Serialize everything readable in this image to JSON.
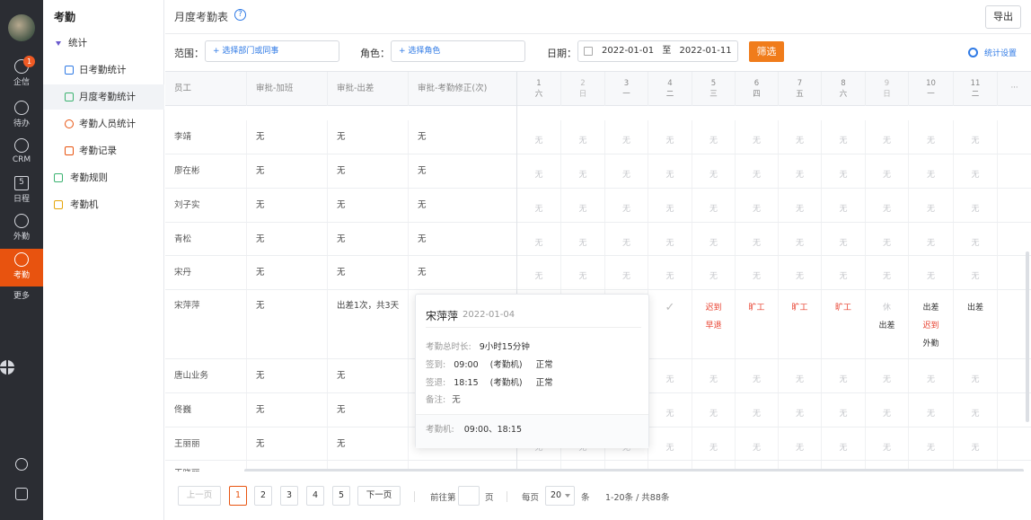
{
  "rail": {
    "items": [
      {
        "label": "企信",
        "badge": "1"
      },
      {
        "label": "待办"
      },
      {
        "label": "CRM"
      },
      {
        "label": "日程",
        "glyph": "5"
      },
      {
        "label": "外勤"
      },
      {
        "label": "考勤"
      },
      {
        "label": "更多"
      }
    ]
  },
  "sidebar": {
    "title": "考勤",
    "group": "统计",
    "items": [
      {
        "label": "日考勤统计"
      },
      {
        "label": "月度考勤统计"
      },
      {
        "label": "考勤人员统计"
      },
      {
        "label": "考勤记录"
      },
      {
        "label": "考勤规则"
      },
      {
        "label": "考勤机"
      }
    ]
  },
  "page": {
    "title": "月度考勤表",
    "help": "?",
    "export_label": "导出"
  },
  "filters": {
    "scope_label": "范围：",
    "scope_placeholder": "+ 选择部门或同事",
    "role_label": "角色：",
    "role_placeholder": "+ 选择角色",
    "date_label": "日期：",
    "date_start": "2022-01-01",
    "date_to": "至",
    "date_end": "2022-01-11",
    "filter_label": "筛选",
    "settings_label": "统计设置"
  },
  "table": {
    "headers": [
      "员工",
      "审批-加班",
      "审批-出差",
      "审批-考勤修正(次)"
    ],
    "days": [
      {
        "d": "1",
        "w": "六"
      },
      {
        "d": "2",
        "w": "日"
      },
      {
        "d": "3",
        "w": "一"
      },
      {
        "d": "4",
        "w": "二"
      },
      {
        "d": "5",
        "w": "三"
      },
      {
        "d": "6",
        "w": "四"
      },
      {
        "d": "7",
        "w": "五"
      },
      {
        "d": "8",
        "w": "六"
      },
      {
        "d": "9",
        "w": "日"
      },
      {
        "d": "10",
        "w": "一"
      },
      {
        "d": "11",
        "w": "二"
      }
    ],
    "more": "···",
    "rows": [
      {
        "name": "李靖",
        "ot": "无",
        "trip": "无",
        "fix": "无"
      },
      {
        "name": "廖在彬",
        "ot": "无",
        "trip": "无",
        "fix": "无"
      },
      {
        "name": "刘子实",
        "ot": "无",
        "trip": "无",
        "fix": "无"
      },
      {
        "name": "青松",
        "ot": "无",
        "trip": "无",
        "fix": "无"
      },
      {
        "name": "宋丹",
        "ot": "无",
        "trip": "无",
        "fix": "无"
      },
      {
        "name": "宋萍萍",
        "ot": "无",
        "trip": "出差1次，共3天",
        "fix": ""
      },
      {
        "name": "唐山业务",
        "ot": "无",
        "trip": "无",
        "fix": ""
      },
      {
        "name": "佟巍",
        "ot": "无",
        "trip": "无",
        "fix": ""
      },
      {
        "name": "王丽丽",
        "ot": "无",
        "trip": "无",
        "fix": ""
      },
      {
        "name": "王晓丽",
        "ot": "无",
        "trip": "",
        "fix": ""
      }
    ],
    "none": "无",
    "special": {
      "d5a": "迟到",
      "d5b": "早退",
      "absent": "旷工",
      "rest": "休",
      "trip": "出差",
      "late": "迟到",
      "field": "外勤"
    }
  },
  "tooltip": {
    "name": "宋萍萍",
    "date": "2022-01-04",
    "duration_key": "考勤总时长:",
    "duration_val": "9小时15分钟",
    "in_key": "签到:",
    "in_time": "09:00",
    "in_src": "(考勤机)",
    "in_status": "正常",
    "out_key": "签退:",
    "out_time": "18:15",
    "out_src": "(考勤机)",
    "out_status": "正常",
    "note_key": "备注:",
    "note_val": "无",
    "machine_key": "考勤机:",
    "machine_val": "09:00、18:15"
  },
  "pager": {
    "prev": "上一页",
    "pages": [
      "1",
      "2",
      "3",
      "4",
      "5"
    ],
    "next": "下一页",
    "goto": "前往第",
    "page_unit": "页",
    "per_page": "每页",
    "size": "20",
    "size_unit": "条",
    "summary": "1-20条 / 共88条"
  }
}
